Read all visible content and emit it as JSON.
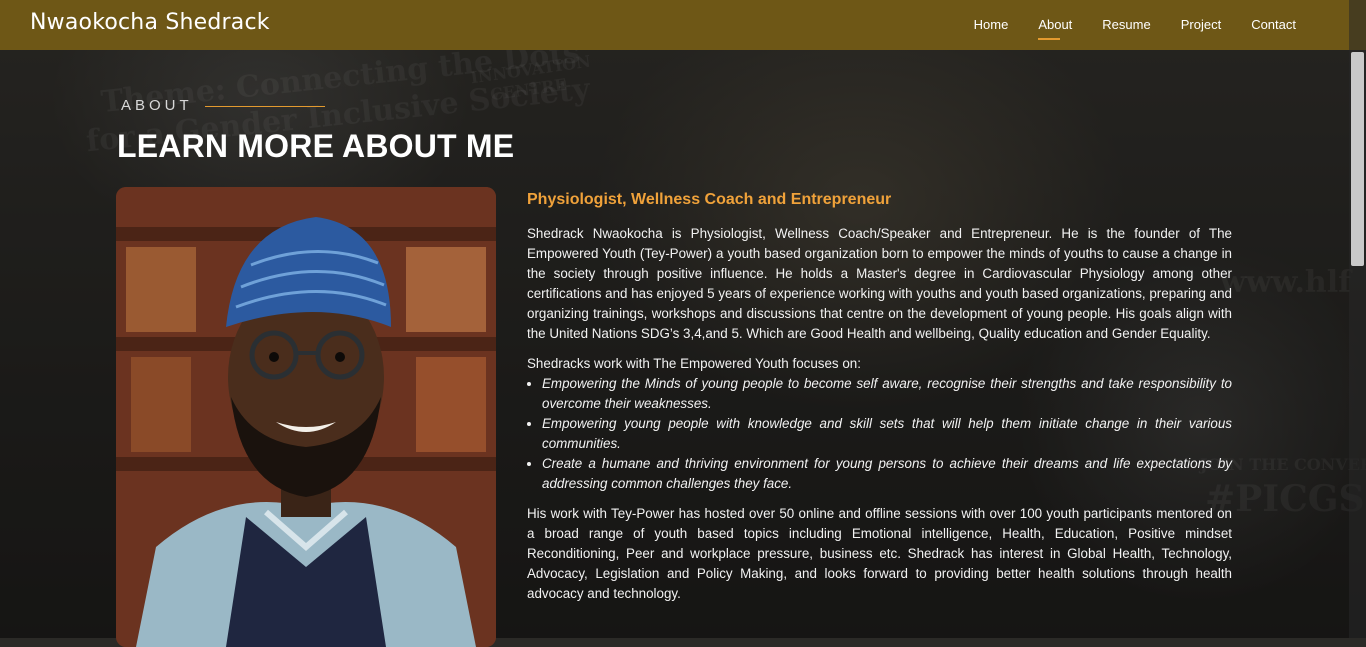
{
  "header": {
    "logo": "Nwaokocha Shedrack",
    "nav": [
      "Home",
      "About",
      "Resume",
      "Project",
      "Contact"
    ],
    "active_nav": "About"
  },
  "section": {
    "eyebrow": "ABOUT",
    "title": "LEARN MORE ABOUT ME"
  },
  "about": {
    "subtitle": "Physiologist, Wellness Coach and Entrepreneur",
    "intro": "Shedrack Nwaokocha is Physiologist, Wellness Coach/Speaker and Entrepreneur. He is the founder of The Empowered Youth (Tey-Power) a youth based organization born to empower the minds of youths to cause a change in the society through positive influence. He holds a Master's degree in Cardiovascular Physiology among other certifications and has enjoyed 5 years of experience working with youths and youth based organizations, preparing and organizing trainings, workshops and discussions that centre on the development of young people. His goals align with the United Nations SDG’s 3,4,and 5. Which are Good Health and wellbeing, Quality education and Gender Equality.",
    "focus_intro": "Shedracks work with The Empowered Youth focuses on:",
    "focus_items": [
      "Empowering the Minds of young people to become self aware, recognise their strengths and take responsibility to overcome their weaknesses.",
      "Empowering young people with knowledge and skill sets that will help them initiate change in their various communities.",
      "Create a humane and thriving environment for young persons to achieve their dreams and life expectations by addressing common challenges they face."
    ],
    "closing": "His work with Tey-Power has hosted over 50 online and offline sessions with over 100 youth participants mentored on a broad range of youth based topics including Emotional intelligence, Health, Education, Positive mindset Reconditioning, Peer and workplace pressure, business etc. Shedrack has interest in Global Health, Technology, Advocacy, Legislation and Policy Making, and looks forward to providing better health solutions through health advocacy and technology."
  },
  "background_text": [
    "Theme: Connecting the Dots",
    "for a Gender Inclusive Society",
    "INNOVATION",
    "CENTRE",
    "www.hlf",
    "JOIN THE CONVERS",
    "#PICGS"
  ],
  "colors": {
    "header": "#6e5716",
    "accent": "#e39a2f",
    "subtitle": "#f0a23a"
  }
}
